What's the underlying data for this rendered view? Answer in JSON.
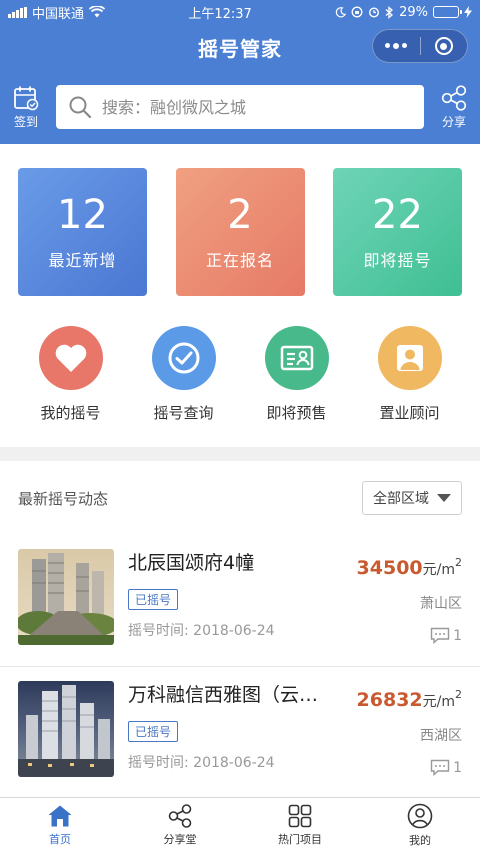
{
  "status_bar": {
    "carrier": "中国联通",
    "time": "上午12:37",
    "battery": "29%",
    "battery_level": 0.29
  },
  "navbar": {
    "title": "摇号管家"
  },
  "header": {
    "checkin_label": "签到",
    "share_label": "分享",
    "search_placeholder": "搜索：融创微风之城"
  },
  "stats": [
    {
      "value": "12",
      "label": "最近新增",
      "color": "#5b8ae0"
    },
    {
      "value": "2",
      "label": "正在报名",
      "color": "#eb8a72"
    },
    {
      "value": "22",
      "label": "即将摇号",
      "color": "#4fc79f"
    }
  ],
  "quick_links": [
    {
      "label": "我的摇号",
      "icon": "heart-icon",
      "color": "#e8776a"
    },
    {
      "label": "摇号查询",
      "icon": "check-icon",
      "color": "#5b9ae6"
    },
    {
      "label": "即将预售",
      "icon": "id-card-icon",
      "color": "#48b98a"
    },
    {
      "label": "置业顾问",
      "icon": "person-icon",
      "color": "#f0b860"
    }
  ],
  "feed": {
    "title": "最新摇号动态",
    "region_filter": "全部区域"
  },
  "listings": [
    {
      "name": "北辰国颂府4幢",
      "price": "34500",
      "unit": "元/m",
      "unit_sup": "2",
      "tag": "已摇号",
      "district": "萧山区",
      "time": "摇号时间: 2018-06-24",
      "comments": "1"
    },
    {
      "name": "万科融信西雅图（云…",
      "price": "26832",
      "unit": "元/m",
      "unit_sup": "2",
      "tag": "已摇号",
      "district": "西湖区",
      "time": "摇号时间: 2018-06-24",
      "comments": "1"
    }
  ],
  "tabs": [
    {
      "label": "首页",
      "icon": "home-icon",
      "active": true
    },
    {
      "label": "分享堂",
      "icon": "share-icon",
      "active": false
    },
    {
      "label": "热门项目",
      "icon": "grid-icon",
      "active": false
    },
    {
      "label": "我的",
      "icon": "user-icon",
      "active": false
    }
  ]
}
